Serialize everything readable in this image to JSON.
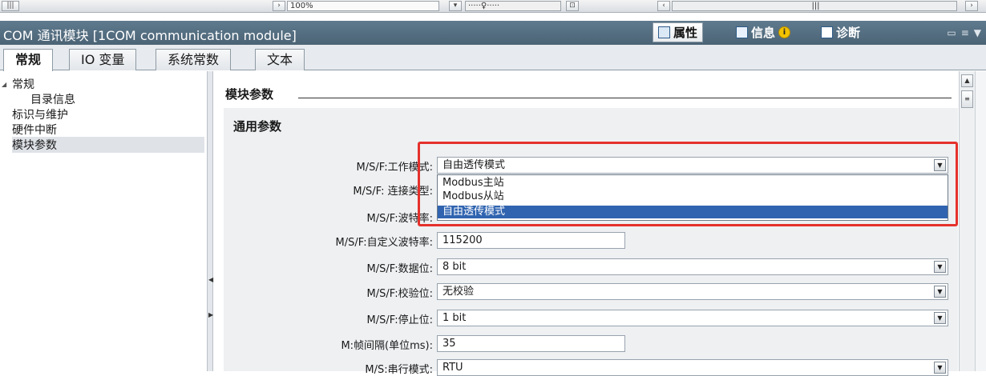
{
  "top_strip": {
    "zoom_value": "100%"
  },
  "titlebar": {
    "title": "COM 通讯模块 [1COM communication module]",
    "tabs": [
      {
        "label": "属性",
        "icon": "properties-icon",
        "active": true
      },
      {
        "label": "信息",
        "icon": "info-list-icon",
        "active": false
      },
      {
        "label": "诊断",
        "icon": "diagnostics-icon",
        "active": false
      }
    ]
  },
  "category_tabs": [
    {
      "label": "常规",
      "active": true
    },
    {
      "label": "IO 变量",
      "active": false
    },
    {
      "label": "系统常数",
      "active": false
    },
    {
      "label": "文本",
      "active": false
    }
  ],
  "nav": {
    "items": [
      {
        "label": "常规",
        "level": 0
      },
      {
        "label": "目录信息",
        "level": 1
      },
      {
        "label": "标识与维护",
        "level": 0
      },
      {
        "label": "硬件中断",
        "level": 0
      },
      {
        "label": "模块参数",
        "level": 0,
        "selected": true
      }
    ]
  },
  "content": {
    "section_title": "模块参数",
    "sub_title": "通用参数",
    "fields": [
      {
        "label": "M/S/F:工作模式:",
        "value": "自由透传模式",
        "type": "select"
      },
      {
        "label": "M/S/F: 连接类型:",
        "value": "",
        "type": "select"
      },
      {
        "label": "M/S/F:波特率:",
        "value": "",
        "type": "select"
      },
      {
        "label": "M/S/F:自定义波特率:",
        "value": "115200",
        "type": "text"
      },
      {
        "label": "M/S/F:数据位:",
        "value": "8 bit",
        "type": "select"
      },
      {
        "label": "M/S/F:校验位:",
        "value": "无校验",
        "type": "select"
      },
      {
        "label": "M/S/F:停止位:",
        "value": "1 bit",
        "type": "select"
      },
      {
        "label": "M:帧间隔(单位ms):",
        "value": "35",
        "type": "text"
      },
      {
        "label": "M/S:串行模式:",
        "value": "RTU",
        "type": "select"
      }
    ],
    "dropdown_options": [
      {
        "label": "Modbus主站",
        "selected": false
      },
      {
        "label": "Modbus从站",
        "selected": false
      },
      {
        "label": "自由透传模式",
        "selected": true
      }
    ]
  },
  "colors": {
    "highlight_border": "#e5312c",
    "selection_blue": "#3064b0",
    "titlebar": "#546e82"
  }
}
